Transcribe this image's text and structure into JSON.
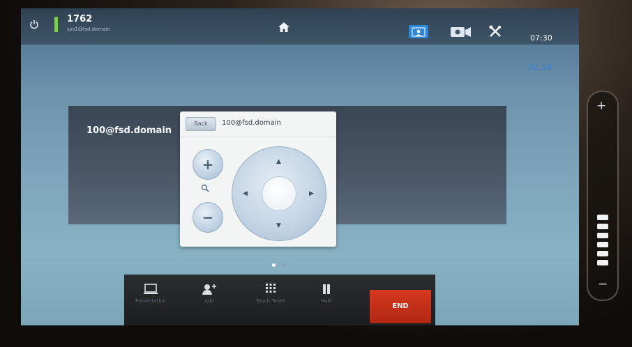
{
  "status": {
    "system_number": "1762",
    "system_uri": "sys1@fsd.domain",
    "clock": "07:30",
    "call_duration": "00:34",
    "status_color": "#7ed04f"
  },
  "topbar_icons": [
    "power-icon",
    "home-icon",
    "selfview-icon",
    "camera-icon",
    "tools-icon"
  ],
  "participant": {
    "name": "100@fsd.domain"
  },
  "camera_control": {
    "back_label": "Back",
    "title": "100@fsd.domain",
    "zoom_in": "+",
    "zoom_out": "−",
    "icons": [
      "zoom-icon",
      "arrow-up-icon",
      "arrow-down-icon",
      "arrow-left-icon",
      "arrow-right-icon"
    ]
  },
  "pager": {
    "pages": 2,
    "active": 1
  },
  "call_controls": {
    "presentation": "Presentation",
    "add": "Add",
    "touch_tones": "Touch Tones",
    "hold": "Hold",
    "end": "END",
    "end_color": "#c9321a"
  },
  "volume": {
    "plus": "+",
    "minus": "−",
    "level_segments": 6
  }
}
